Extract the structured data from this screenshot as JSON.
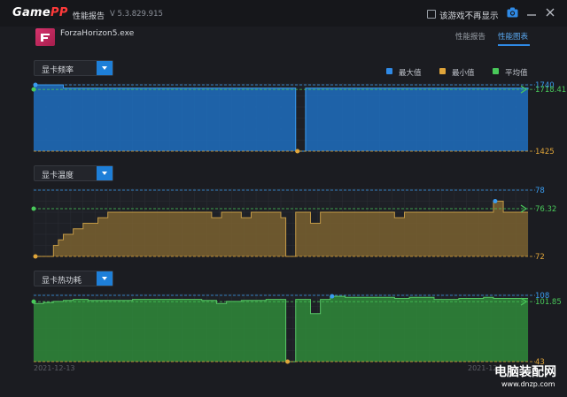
{
  "titlebar": {
    "logo_main": "Game",
    "logo_accent": "PP",
    "window_title": "性能报告",
    "version": "V 5.3.829.915",
    "checkbox_label": "该游戏不再显示"
  },
  "game": {
    "name": "ForzaHorizon5.exe"
  },
  "tabs": [
    {
      "label": "性能报告",
      "active": false
    },
    {
      "label": "性能图表",
      "active": true
    }
  ],
  "legend": [
    {
      "label": "最大值",
      "color": "#2f8ae6"
    },
    {
      "label": "最小值",
      "color": "#e0a53a"
    },
    {
      "label": "平均值",
      "color": "#49c95a"
    }
  ],
  "dates": {
    "start": "2021-12-13",
    "end": "2021-12"
  },
  "watermark": {
    "title": "电脑装配网",
    "url": "www.dnzp.com"
  },
  "chart_data": [
    {
      "type": "area",
      "selector_label": "显卡频率",
      "max_label": "1740",
      "avg_label": "1718.41",
      "min_label": "1425",
      "ylim": [
        1425,
        1740
      ],
      "fill": "#1f6fbf",
      "stroke": "#3a9cf0",
      "x": [
        0,
        1,
        2,
        3,
        4,
        5,
        6,
        7,
        8,
        9,
        10,
        11,
        12,
        13,
        14,
        15,
        16,
        17,
        18,
        19,
        20,
        21,
        22,
        23,
        24,
        25,
        26,
        27,
        28,
        29,
        30,
        31,
        32,
        33,
        34,
        35,
        36,
        37,
        38,
        39,
        40,
        41,
        42,
        43,
        44,
        45,
        46,
        47,
        48,
        49,
        50,
        51,
        52,
        53,
        54,
        55,
        56,
        57,
        58,
        59,
        60,
        61,
        62,
        63,
        64,
        65,
        66,
        67,
        68,
        69,
        70,
        71,
        72,
        73,
        74,
        75,
        76,
        77,
        78,
        79,
        80,
        81,
        82,
        83,
        84,
        85,
        86,
        87,
        88,
        89,
        90,
        91,
        92,
        93,
        94,
        95,
        96,
        97,
        98,
        99,
        100
      ],
      "values": [
        1740,
        1740,
        1740,
        1740,
        1740,
        1740,
        1725,
        1725,
        1725,
        1725,
        1725,
        1725,
        1725,
        1725,
        1725,
        1725,
        1725,
        1725,
        1725,
        1725,
        1725,
        1725,
        1725,
        1725,
        1725,
        1725,
        1725,
        1725,
        1725,
        1725,
        1725,
        1725,
        1725,
        1725,
        1725,
        1725,
        1725,
        1725,
        1725,
        1725,
        1725,
        1725,
        1725,
        1725,
        1725,
        1725,
        1725,
        1725,
        1725,
        1725,
        1725,
        1725,
        1725,
        1425,
        1425,
        1725,
        1725,
        1725,
        1725,
        1725,
        1725,
        1725,
        1725,
        1725,
        1725,
        1725,
        1725,
        1725,
        1725,
        1725,
        1725,
        1725,
        1725,
        1725,
        1725,
        1725,
        1725,
        1725,
        1725,
        1725,
        1725,
        1725,
        1725,
        1725,
        1725,
        1725,
        1725,
        1725,
        1725,
        1725,
        1725,
        1725,
        1725,
        1725,
        1725,
        1725,
        1725,
        1725,
        1725,
        1725,
        1718
      ]
    },
    {
      "type": "area",
      "selector_label": "显卡温度",
      "max_label": "78",
      "avg_label": "76.32",
      "min_label": "72",
      "ylim": [
        72,
        78
      ],
      "fill": "#7a6230",
      "stroke": "#c39a46",
      "x": [
        0,
        1,
        2,
        3,
        4,
        5,
        6,
        7,
        8,
        9,
        10,
        11,
        12,
        13,
        14,
        15,
        16,
        17,
        18,
        19,
        20,
        21,
        22,
        23,
        24,
        25,
        26,
        27,
        28,
        29,
        30,
        31,
        32,
        33,
        34,
        35,
        36,
        37,
        38,
        39,
        40,
        41,
        42,
        43,
        44,
        45,
        46,
        47,
        48,
        49,
        50,
        51,
        52,
        53,
        54,
        55,
        56,
        57,
        58,
        59,
        60,
        61,
        62,
        63,
        64,
        65,
        66,
        67,
        68,
        69,
        70,
        71,
        72,
        73,
        74,
        75,
        76,
        77,
        78,
        79,
        80,
        81,
        82,
        83,
        84,
        85,
        86,
        87,
        88,
        89,
        90,
        91,
        92,
        93,
        94,
        95,
        96,
        97,
        98,
        99,
        100
      ],
      "values": [
        72,
        72,
        72,
        72,
        73,
        73.5,
        74,
        74,
        74.5,
        74.5,
        75,
        75,
        75,
        75.5,
        75.5,
        76,
        76,
        76,
        76,
        76,
        76,
        76,
        76,
        76,
        76,
        76,
        76,
        76,
        76,
        76,
        76,
        76,
        76,
        76,
        76,
        76,
        75.5,
        75.5,
        76,
        76,
        76,
        76,
        75.5,
        75.5,
        76,
        76,
        76,
        76,
        76,
        76,
        75.5,
        72,
        72,
        76,
        76,
        76,
        75,
        75,
        76,
        76,
        76,
        76,
        76,
        76,
        76,
        76,
        76,
        76,
        76,
        76,
        76,
        76,
        76,
        75.5,
        75.5,
        76,
        76,
        76,
        76,
        76,
        76,
        76,
        76,
        76,
        76,
        76,
        76,
        76,
        76,
        76,
        76,
        76,
        76,
        77,
        77,
        76,
        76,
        76,
        76,
        76,
        76
      ]
    },
    {
      "type": "area",
      "selector_label": "显卡热功耗",
      "max_label": "108",
      "avg_label": "101.85",
      "min_label": "43",
      "ylim": [
        43,
        108
      ],
      "fill": "#2f8a3a",
      "stroke": "#57c765",
      "x": [
        0,
        1,
        2,
        3,
        4,
        5,
        6,
        7,
        8,
        9,
        10,
        11,
        12,
        13,
        14,
        15,
        16,
        17,
        18,
        19,
        20,
        21,
        22,
        23,
        24,
        25,
        26,
        27,
        28,
        29,
        30,
        31,
        32,
        33,
        34,
        35,
        36,
        37,
        38,
        39,
        40,
        41,
        42,
        43,
        44,
        45,
        46,
        47,
        48,
        49,
        50,
        51,
        52,
        53,
        54,
        55,
        56,
        57,
        58,
        59,
        60,
        61,
        62,
        63,
        64,
        65,
        66,
        67,
        68,
        69,
        70,
        71,
        72,
        73,
        74,
        75,
        76,
        77,
        78,
        79,
        80,
        81,
        82,
        83,
        84,
        85,
        86,
        87,
        88,
        89,
        90,
        91,
        92,
        93,
        94,
        95,
        96,
        97,
        98,
        99,
        100
      ],
      "values": [
        100,
        100,
        101,
        101,
        102,
        102,
        103,
        103,
        104,
        104,
        104,
        103,
        103,
        103,
        103,
        103,
        103,
        103,
        103,
        103,
        104,
        104,
        104,
        104,
        104,
        104,
        104,
        104,
        104,
        104,
        104,
        104,
        104,
        104,
        103,
        103,
        103,
        100,
        100,
        102,
        102,
        102,
        103,
        103,
        103,
        103,
        103,
        104,
        104,
        104,
        104,
        43,
        43,
        104,
        104,
        104,
        90,
        90,
        104,
        104,
        107,
        107,
        107,
        106,
        106,
        106,
        106,
        106,
        106,
        106,
        106,
        106,
        106,
        105,
        105,
        105,
        106,
        106,
        106,
        106,
        106,
        104,
        104,
        104,
        104,
        104,
        105,
        105,
        105,
        105,
        105,
        106,
        106,
        105,
        105,
        105,
        105,
        105,
        105,
        105,
        105
      ]
    }
  ]
}
